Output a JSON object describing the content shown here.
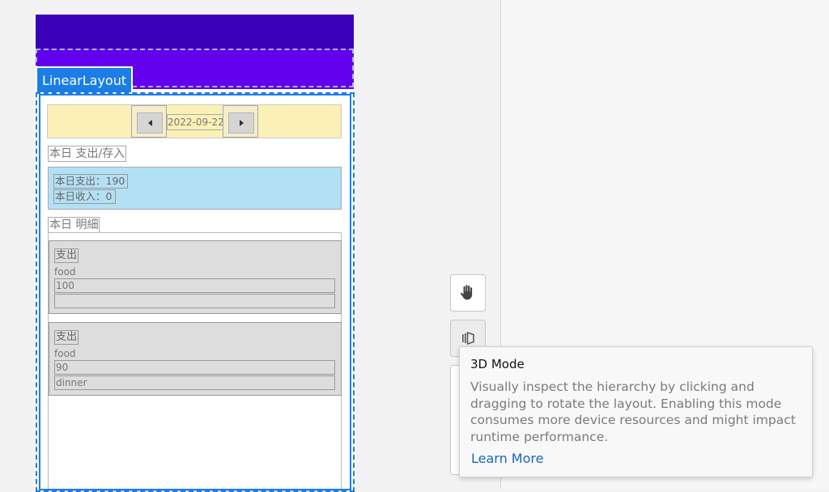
{
  "preview": {
    "selected_component": "LinearLayout",
    "colors": {
      "status_bar": "#3a00b8",
      "toolbar": "#6200ee",
      "selection": "#1b7ee6",
      "date_bar": "#fbf1b6",
      "summary": "#b4e0f5",
      "card": "#dddddd"
    },
    "date_nav": {
      "date": "2022-09-22",
      "prev_icon": "arrow-left",
      "next_icon": "arrow-right"
    },
    "summary_section_label": "本日 支出/存入",
    "summary": {
      "expense": "本日支出：190",
      "income": "本日收入：0"
    },
    "details_section_label": "本日 明細",
    "entries": [
      {
        "type": "支出",
        "category": "food",
        "amount": "100",
        "note": ""
      },
      {
        "type": "支出",
        "category": "food",
        "amount": "90",
        "note": "dinner"
      }
    ]
  },
  "tools": {
    "pan_icon": "hand-icon",
    "mode_icon": "3d-layers-icon"
  },
  "tooltip": {
    "title": "3D Mode",
    "body": "Visually inspect the hierarchy by clicking and dragging to rotate the layout. Enabling this mode consumes more device resources and might impact runtime performance.",
    "link": "Learn More",
    "link_color": "#1566c0"
  }
}
